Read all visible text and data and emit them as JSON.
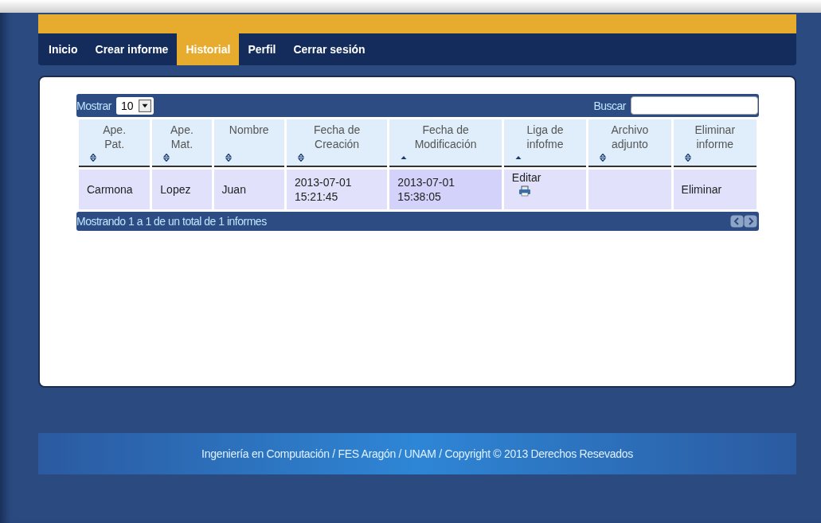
{
  "nav": [
    {
      "label": "Inicio",
      "selected": false
    },
    {
      "label": "Crear informe",
      "selected": false
    },
    {
      "label": "Historial",
      "selected": true
    },
    {
      "label": "Perfil",
      "selected": false
    },
    {
      "label": "Cerrar sesión",
      "selected": false
    }
  ],
  "table": {
    "length_label": "Mostrar",
    "length_value": "10",
    "search_label": "Buscar",
    "columns": [
      {
        "label": "Ape. Pat.",
        "ascending": false,
        "sorted": false
      },
      {
        "label": "Ape. Mat.",
        "ascending": false,
        "sorted": false
      },
      {
        "label": "Nombre",
        "ascending": false,
        "sorted": false
      },
      {
        "label": "Fecha de Creación",
        "ascending": false,
        "sorted": false
      },
      {
        "label": "Fecha de Modificación",
        "ascending": true,
        "sorted": true
      },
      {
        "label": "Liga de infofme",
        "ascending": true,
        "sorted": false
      },
      {
        "label": "Archivo adjunto",
        "ascending": false,
        "sorted": false
      },
      {
        "label": "Eliminar informe",
        "ascending": false,
        "sorted": false
      }
    ],
    "rows": [
      {
        "ape_pat": "Carmona",
        "ape_mat": "Lopez",
        "nombre": "Juan",
        "fecha_creacion": "2013-07-01 15:21:45",
        "fecha_modificacion": "2013-07-01 15:38:05",
        "liga": "Editar",
        "eliminar": "Eliminar"
      }
    ],
    "info": "Mostrando 1 a 1 de un total de 1 informes"
  },
  "footer": "Ingeniería en Computación / FES Aragón / UNAM / Copyright © 2013 Derechos Resevados"
}
